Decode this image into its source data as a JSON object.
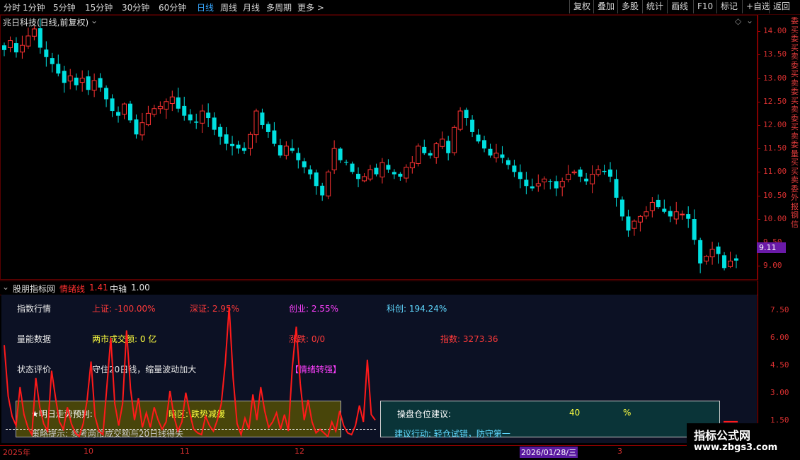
{
  "toolbar": {
    "periods": [
      "分时",
      "1分钟",
      "5分钟",
      "15分钟",
      "30分钟",
      "60分钟",
      "日线",
      "周线",
      "月线",
      "多周期",
      "更多"
    ],
    "active_period": "日线",
    "more_arrow": ">",
    "buttons": [
      "复权",
      "叠加",
      "多股",
      "统计",
      "画线",
      "F10",
      "标记",
      "+自选",
      "返回"
    ]
  },
  "price_panel": {
    "title": "兆日科技(日线,前复权)",
    "current_price": "9.11",
    "y_ticks": [
      "14.00",
      "13.50",
      "13.00",
      "12.50",
      "12.00",
      "11.50",
      "11.00",
      "10.50",
      "10.00",
      "9.50",
      "9.00"
    ]
  },
  "side_column": {
    "text": "委买委买卖委买卖委买卖委买卖委量买买卖委外报钢信"
  },
  "indicator": {
    "name": "股朋指标网",
    "line_label": "情绪线",
    "line_value": "1.41",
    "axis_label": "中轴",
    "axis_value": "1.00",
    "y_ticks": [
      "7.50",
      "6.00",
      "4.50",
      "3.00",
      "1.50"
    ],
    "line_color": "#ff1a1a"
  },
  "info": {
    "index_label": "指数行情",
    "sh": "上证: -100.00%",
    "sz": "深证: 2.95%",
    "cy": "创业: 2.55%",
    "kc": "科创: 194.24%",
    "volume_label": "量能数据",
    "turnover": "两市成交额: 0 亿",
    "updown": "涨跌: 0/0",
    "index_value": "指数: 3273.36",
    "status_label": "状态评价",
    "status_text": "守住20日线，缩量波动加大",
    "mood": "【情绪转强】",
    "predict_label": "★明日走势预判:",
    "predict_value": "暗区: 跌势减缓",
    "strategy": "策略提示: 参考两市成交额与20日线得失",
    "position_label": "操盘仓位建议:",
    "position_value": "40",
    "position_unit": "%",
    "action": "建议行动: 轻仓试错，防守第一"
  },
  "date_axis": {
    "labels": [
      "2025年",
      "10",
      "11",
      "12",
      "3"
    ],
    "cursor_date": "2026/01/28/三"
  },
  "watermark": {
    "title": "指标公式网",
    "url": "www.zbgs3.com"
  },
  "chart_data": {
    "type": "candlestick",
    "up_color": "#ff3232",
    "down_color": "#00e0e0",
    "ylim": [
      8.85,
      14.2
    ],
    "closes": [
      13.6,
      13.8,
      13.55,
      13.7,
      13.9,
      14.05,
      13.65,
      13.45,
      13.3,
      13.1,
      12.9,
      13.05,
      12.85,
      13.0,
      12.75,
      12.95,
      12.8,
      12.55,
      12.3,
      12.2,
      12.45,
      12.1,
      11.8,
      12.05,
      12.25,
      12.35,
      12.4,
      12.5,
      12.6,
      12.35,
      12.2,
      12.1,
      12.05,
      12.3,
      12.15,
      11.9,
      11.75,
      11.6,
      11.55,
      11.5,
      11.45,
      11.8,
      12.3,
      12.0,
      11.85,
      11.6,
      11.35,
      11.55,
      11.45,
      11.25,
      11.1,
      10.95,
      10.7,
      10.5,
      11.0,
      11.5,
      11.25,
      11.2,
      11.0,
      10.85,
      10.9,
      11.05,
      10.95,
      11.2,
      11.05,
      10.95,
      10.9,
      11.1,
      11.2,
      11.55,
      11.4,
      11.35,
      11.6,
      11.7,
      11.4,
      11.95,
      12.3,
      12.15,
      11.85,
      11.65,
      11.5,
      11.35,
      11.4,
      11.3,
      11.15,
      11.0,
      10.85,
      10.7,
      10.65,
      10.75,
      10.85,
      10.8,
      10.65,
      10.8,
      10.95,
      11.0,
      10.9,
      10.8,
      10.95,
      11.05,
      11.0,
      10.9,
      10.45,
      10.05,
      9.75,
      9.95,
      10.05,
      10.15,
      10.35,
      10.25,
      10.15,
      10.05,
      10.15,
      10.1,
      10.0,
      9.55,
      9.05,
      9.2,
      9.35,
      9.25,
      8.95,
      9.1,
      9.11
    ],
    "indicator_values": [
      5.6,
      2.8,
      1.7,
      1.2,
      3.3,
      1.8,
      1.1,
      0.7,
      3.8,
      2.2,
      1.3,
      0.9,
      4.2,
      2.7,
      1.4,
      1.0,
      2.2,
      1.3,
      0.8,
      0.6,
      1.3,
      2.6,
      4.7,
      1.7,
      0.9,
      0.7,
      3.3,
      6.0,
      2.4,
      1.2,
      2.4,
      6.4,
      3.2,
      1.5,
      2.7,
      1.1,
      1.9,
      1.1,
      2.2,
      1.5,
      1.0,
      1.4,
      3.1,
      1.7,
      0.9,
      1.4,
      3.0,
      1.9,
      1.0,
      0.8,
      0.7,
      1.7,
      1.2,
      0.9,
      1.5,
      2.4,
      4.6,
      7.7,
      3.8,
      1.3,
      0.7,
      1.6,
      1.0,
      2.9,
      1.5,
      3.3,
      2.0,
      1.1,
      1.4,
      1.9,
      1.0,
      1.8,
      0.9,
      4.4,
      6.6,
      3.5,
      1.5,
      2.6,
      1.4,
      0.8,
      1.0,
      0.8,
      0.6,
      1.4,
      0.9,
      2.0,
      1.2,
      0.8,
      0.7,
      1.2,
      2.3,
      1.4,
      4.8,
      1.8,
      1.5
    ],
    "indicator_ylim": [
      0.4,
      8.2
    ],
    "axis_value": 1.0
  }
}
